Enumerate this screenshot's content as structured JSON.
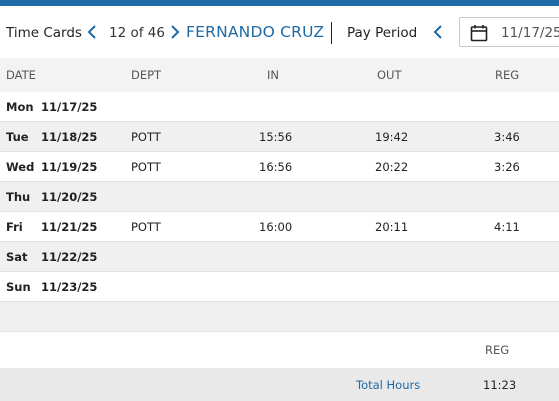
{
  "header": {
    "title": "Time Cards",
    "counter": "12 of 46",
    "employee_name": "FERNANDO CRUZ",
    "pay_period_label": "Pay Period",
    "pay_period_date": "11/17/25"
  },
  "table": {
    "columns": [
      "DATE",
      "DEPT",
      "IN",
      "OUT",
      "REG"
    ],
    "rows": [
      {
        "day": "Mon",
        "date": "11/17/25",
        "dept": "",
        "in": "",
        "out": "",
        "reg": ""
      },
      {
        "day": "Tue",
        "date": "11/18/25",
        "dept": "POTT",
        "in": "15:56",
        "out": "19:42",
        "reg": "3:46"
      },
      {
        "day": "Wed",
        "date": "11/19/25",
        "dept": "POTT",
        "in": "16:56",
        "out": "20:22",
        "reg": "3:26"
      },
      {
        "day": "Thu",
        "date": "11/20/25",
        "dept": "",
        "in": "",
        "out": "",
        "reg": ""
      },
      {
        "day": "Fri",
        "date": "11/21/25",
        "dept": "POTT",
        "in": "16:00",
        "out": "20:11",
        "reg": "4:11"
      },
      {
        "day": "Sat",
        "date": "11/22/25",
        "dept": "",
        "in": "",
        "out": "",
        "reg": ""
      },
      {
        "day": "Sun",
        "date": "11/23/25",
        "dept": "",
        "in": "",
        "out": "",
        "reg": ""
      }
    ]
  },
  "summary": {
    "column": "REG",
    "total_label": "Total Hours",
    "total_value": "11:23"
  },
  "colors": {
    "accent": "#1f6aa5",
    "alt_row": "#f0f0f0"
  }
}
